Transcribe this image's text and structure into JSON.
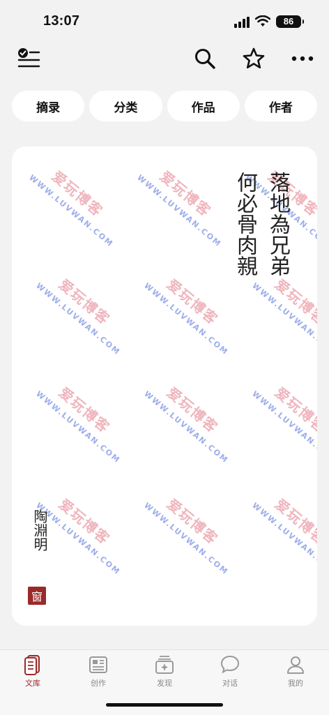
{
  "status": {
    "time": "13:07",
    "battery": "86"
  },
  "toolbar": {
    "icons": [
      "checklist-menu-icon",
      "search-icon",
      "star-icon",
      "more-icon"
    ]
  },
  "filters": [
    {
      "label": "摘录"
    },
    {
      "label": "分类"
    },
    {
      "label": "作品"
    },
    {
      "label": "作者"
    }
  ],
  "card": {
    "poem_lines": [
      "落地為兄弟",
      "何必骨肉親"
    ],
    "author": "陶淵明",
    "seal": "窗",
    "watermark": {
      "cn": "爱玩博客",
      "en": "WWW.LUVWAN.COM"
    }
  },
  "tabs": [
    {
      "label": "文库",
      "icon": "library-icon",
      "active": true
    },
    {
      "label": "创作",
      "icon": "compose-icon",
      "active": false
    },
    {
      "label": "发现",
      "icon": "discover-icon",
      "active": false
    },
    {
      "label": "对话",
      "icon": "chat-icon",
      "active": false
    },
    {
      "label": "我的",
      "icon": "profile-icon",
      "active": false
    }
  ],
  "colors": {
    "accent": "#9b2b2b",
    "background": "#f2f2f2",
    "card": "#ffffff"
  }
}
